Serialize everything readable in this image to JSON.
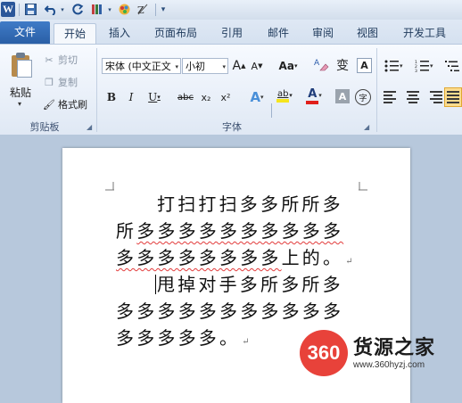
{
  "qat": {
    "app_icon": "W",
    "icons": [
      "word-icon",
      "save-icon",
      "undo-icon",
      "redo-icon",
      "format-painter-icon",
      "color-icon",
      "clear-format-icon",
      "customize-qat-icon"
    ]
  },
  "tabs": [
    {
      "label": "文件"
    },
    {
      "label": "开始"
    },
    {
      "label": "插入"
    },
    {
      "label": "页面布局"
    },
    {
      "label": "引用"
    },
    {
      "label": "邮件"
    },
    {
      "label": "审阅"
    },
    {
      "label": "视图"
    },
    {
      "label": "开发工具"
    }
  ],
  "clipboard": {
    "paste_label": "粘贴",
    "cut_label": "剪切",
    "copy_label": "复制",
    "format_painter_label": "格式刷",
    "group_label": "剪贴板"
  },
  "font": {
    "font_name": "宋体 (中文正文",
    "font_size": "小初",
    "grow_label": "A",
    "shrink_label": "A",
    "case_label": "Aa",
    "bold": "B",
    "italic": "I",
    "underline": "U",
    "strike": "abc",
    "subscript": "x₂",
    "superscript": "x²",
    "effects": "A",
    "highlight": "ab",
    "font_color": "A",
    "char_shade": "A",
    "enclose": "字",
    "phonetic": "变",
    "border": "A",
    "group_label": "字体",
    "colors": {
      "font_color": "#e0201b",
      "highlight": "#f5e51d"
    }
  },
  "document": {
    "lines": [
      {
        "text": "打扫打扫多多所所多",
        "indent": true,
        "pm": false
      },
      {
        "plain": "所",
        "squiggle": "多多多多多多多多多多",
        "pm": false
      },
      {
        "squiggle": "多多多多多多多多",
        "plain": "上的。",
        "pm": true
      },
      {
        "text": "甩掉对手多所多所多",
        "indent": true,
        "caret": true,
        "pm": false
      },
      {
        "text": "多多多多多多多多多多多",
        "pm": false
      },
      {
        "text": "多多多多多。",
        "pm": true
      }
    ]
  },
  "watermark": {
    "badge": "360",
    "title": "货源之家",
    "url": "www.360hyzj.com"
  }
}
